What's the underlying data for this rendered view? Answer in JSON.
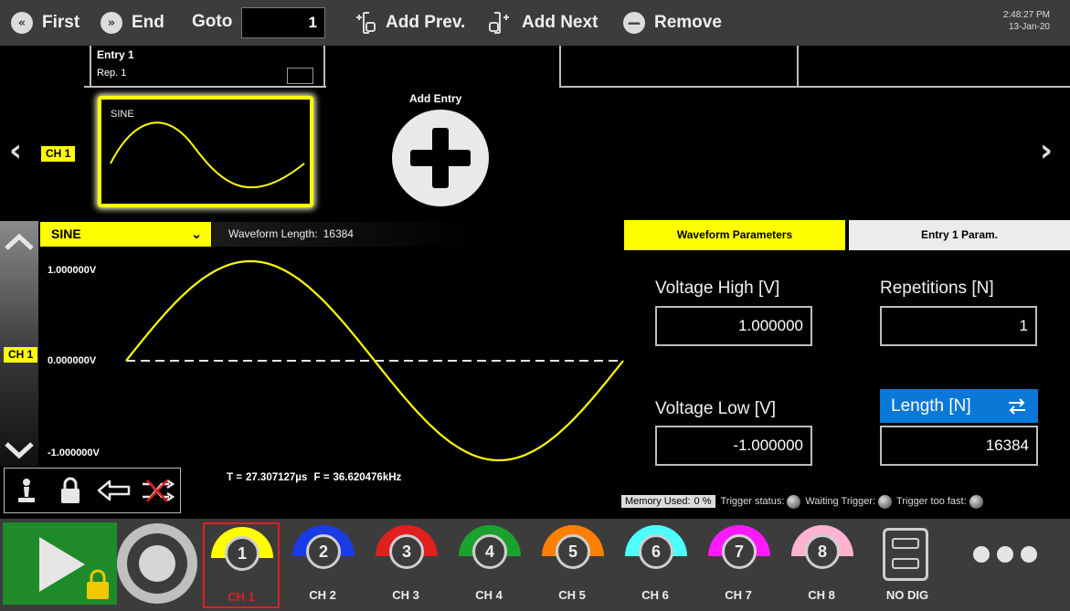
{
  "toolbar": {
    "first_label": "First",
    "end_label": "End",
    "goto_label": "Goto",
    "goto_value": "1",
    "add_prev_label": "Add Prev.",
    "add_next_label": "Add Next",
    "remove_label": "Remove",
    "time": "2:48:27 PM",
    "date": "13-Jan-20"
  },
  "timeline": {
    "entry_title": "Entry  1",
    "entry_rep": "Rep.  1",
    "channel_tag": "CH 1",
    "thumb_label": "SINE",
    "add_entry_label": "Add Entry"
  },
  "waveform": {
    "type": "SINE",
    "length_label": "Waveform Length:",
    "length_value": "16384",
    "channel_tag": "CH 1",
    "y_high": "1.000000V",
    "y_mid": "0.000000V",
    "y_low": "-1.000000V",
    "t_label": "T =",
    "t_value": "27.307127µs",
    "f_label": "F =",
    "f_value": "36.620476kHz",
    "trace_color": "#ffff00"
  },
  "params": {
    "tab_waveform": "Waveform Parameters",
    "tab_entry": "Entry  1  Param.",
    "voltage_high_label": "Voltage High [V]",
    "voltage_high_value": "1.000000",
    "repetitions_label": "Repetitions [N]",
    "repetitions_value": "1",
    "voltage_low_label": "Voltage Low [V]",
    "voltage_low_value": "-1.000000",
    "length_label": "Length [N]",
    "length_value": "16384"
  },
  "status": {
    "memory_label": "Memory Used:",
    "memory_value": "0 %",
    "trigger_status_label": "Trigger status:",
    "waiting_trigger_label": "Waiting Trigger:",
    "trigger_too_fast_label": "Trigger too fast:"
  },
  "channels": [
    {
      "num": "1",
      "name": "CH 1",
      "color": "#ffff00",
      "selected": true
    },
    {
      "num": "2",
      "name": "CH 2",
      "color": "#1a3ce6"
    },
    {
      "num": "3",
      "name": "CH 3",
      "color": "#e01f1f"
    },
    {
      "num": "4",
      "name": "CH 4",
      "color": "#1aa12e"
    },
    {
      "num": "5",
      "name": "CH 5",
      "color": "#ff8000"
    },
    {
      "num": "6",
      "name": "CH 6",
      "color": "#4dffff"
    },
    {
      "num": "7",
      "name": "CH 7",
      "color": "#ff1aff"
    },
    {
      "num": "8",
      "name": "CH 8",
      "color": "#ffb3d1"
    }
  ],
  "nodig_label": "NO DIG",
  "colors": {
    "accent_yellow": "#ffff00",
    "accent_blue": "#0a78d7",
    "run_green": "#1e8a2a",
    "selection_red": "#e02020"
  }
}
